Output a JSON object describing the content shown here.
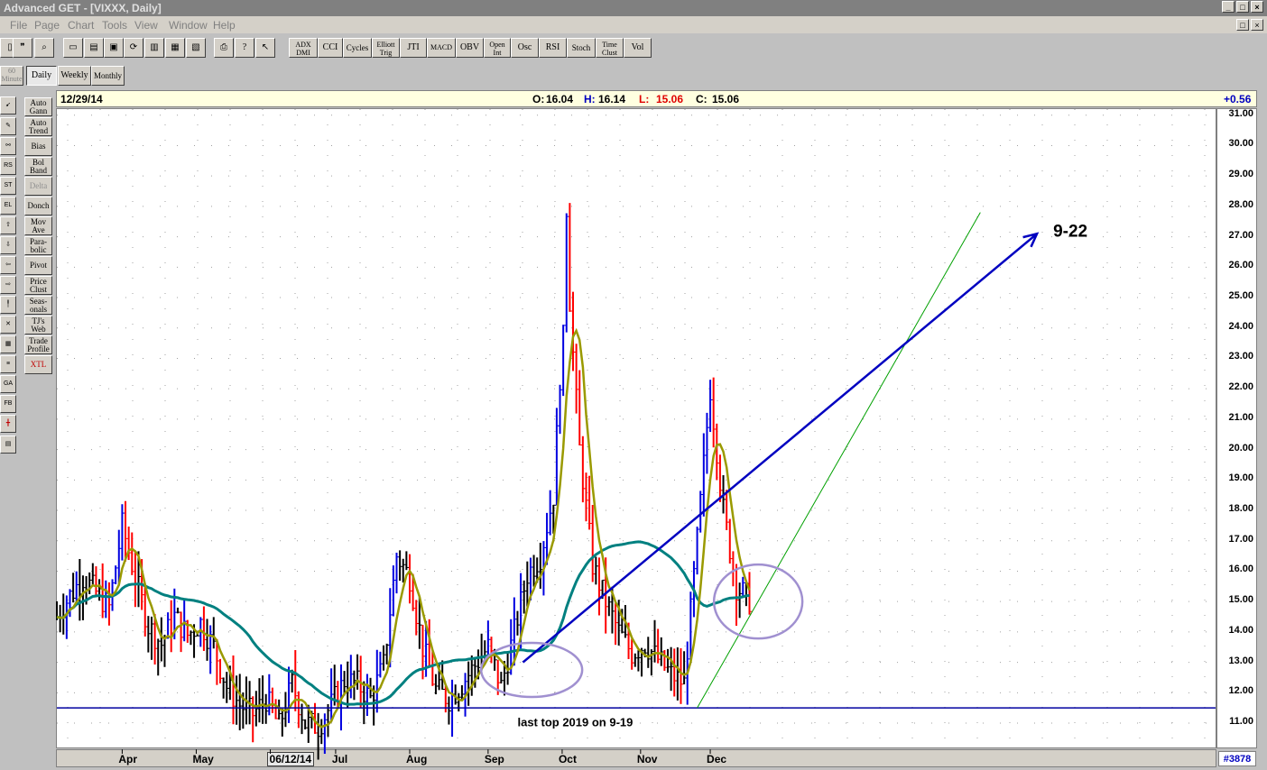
{
  "window": {
    "title": "Advanced GET - [VIXXX, Daily]",
    "controls": [
      "_",
      "□",
      "×"
    ]
  },
  "menu": [
    "File",
    "Page",
    "Chart",
    "Tools",
    "View",
    "Window",
    "Help"
  ],
  "toolbar": {
    "indicators": [
      "ADX DMI",
      "CCI",
      "Cycles",
      "Elliott Trig",
      "JTI",
      "MACD",
      "OBV",
      "Open Int",
      "Osc",
      "RSI",
      "Stoch",
      "Time Clust",
      "Vol"
    ]
  },
  "timeframe_tabs": [
    {
      "label": "60 Minute",
      "active": false
    },
    {
      "label": "Daily",
      "active": true
    },
    {
      "label": "Weekly",
      "active": false
    },
    {
      "label": "Monthly",
      "active": false
    }
  ],
  "side_tools": [
    "Auto Gann",
    "Auto Trend",
    "Bias",
    "Bol Band",
    "Delta",
    "Donch",
    "Mov Ave",
    "Para-bolic",
    "Pivot",
    "Price Clust",
    "Seas-onals",
    "TJ's Web",
    "Trade Profile",
    "XTL"
  ],
  "left_icons": [
    "pointer-icon",
    "draw-icon",
    "zoom-icon",
    "reset-icon",
    "study-icon",
    "elliott-icon",
    "arrow-up-icon",
    "arrow-down-icon",
    "arrow-left-icon",
    "arrow-right-icon",
    "line-icon",
    "x-icon",
    "grid-icon",
    "lines-icon",
    "gann-icon",
    "fib-icon",
    "cross-icon",
    "print-icon"
  ],
  "infobar": {
    "date": "12/29/14",
    "open_label": "O:",
    "open": "16.04",
    "high_label": "H:",
    "high": "16.14",
    "low_label": "L:",
    "low": "15.06",
    "close_label": "C:",
    "close": "15.06",
    "change": "+0.56"
  },
  "counter": "#3878",
  "chart_data": {
    "type": "line",
    "symbol": "VIXXX",
    "interval": "Daily",
    "ylim": [
      10.2,
      31.2
    ],
    "y_ticks": [
      "11.00",
      "12.00",
      "13.00",
      "14.00",
      "15.00",
      "16.00",
      "17.00",
      "18.00",
      "19.00",
      "20.00",
      "21.00",
      "22.00",
      "23.00",
      "24.00",
      "25.00",
      "26.00",
      "27.00",
      "28.00",
      "29.00",
      "30.00",
      "31.00"
    ],
    "x_tick_labels": [
      "Apr",
      "May",
      "06/12/14",
      "Jul",
      "Aug",
      "Sep",
      "Oct",
      "Nov",
      "Dec"
    ],
    "x_tick_positions": [
      3,
      20,
      37,
      52,
      69,
      87,
      104,
      122,
      138
    ],
    "x_range": [
      -12,
      254
    ],
    "grid": true,
    "bars_color_legend": {
      "up": "#0000e0",
      "down": "#ff0000",
      "neutral": "#000000"
    },
    "close_series": [
      {
        "x": -12,
        "close": 14.5
      },
      {
        "x": -9,
        "close": 15.2
      },
      {
        "x": -6,
        "close": 15.8
      },
      {
        "x": -3,
        "close": 15.3
      },
      {
        "x": 0,
        "close": 14.8
      },
      {
        "x": 3,
        "close": 17.5
      },
      {
        "x": 6,
        "close": 15.8
      },
      {
        "x": 9,
        "close": 14.2
      },
      {
        "x": 12,
        "close": 13.6
      },
      {
        "x": 15,
        "close": 14.5
      },
      {
        "x": 18,
        "close": 13.9
      },
      {
        "x": 21,
        "close": 14.3
      },
      {
        "x": 24,
        "close": 13.5
      },
      {
        "x": 27,
        "close": 12.2
      },
      {
        "x": 30,
        "close": 11.6
      },
      {
        "x": 33,
        "close": 11.3
      },
      {
        "x": 36,
        "close": 11.8
      },
      {
        "x": 39,
        "close": 10.9
      },
      {
        "x": 42,
        "close": 12.3
      },
      {
        "x": 45,
        "close": 11.0
      },
      {
        "x": 48,
        "close": 10.9
      },
      {
        "x": 51,
        "close": 11.6
      },
      {
        "x": 54,
        "close": 12.4
      },
      {
        "x": 57,
        "close": 12.3
      },
      {
        "x": 60,
        "close": 11.8
      },
      {
        "x": 63,
        "close": 12.9
      },
      {
        "x": 66,
        "close": 16.5
      },
      {
        "x": 69,
        "close": 15.8
      },
      {
        "x": 72,
        "close": 13.5
      },
      {
        "x": 75,
        "close": 12.1
      },
      {
        "x": 78,
        "close": 11.8
      },
      {
        "x": 81,
        "close": 12.3
      },
      {
        "x": 84,
        "close": 12.9
      },
      {
        "x": 87,
        "close": 13.5
      },
      {
        "x": 90,
        "close": 12.2
      },
      {
        "x": 93,
        "close": 14.0
      },
      {
        "x": 96,
        "close": 15.9
      },
      {
        "x": 99,
        "close": 16.5
      },
      {
        "x": 102,
        "close": 18.5
      },
      {
        "x": 105,
        "close": 26.3
      },
      {
        "x": 108,
        "close": 20.0
      },
      {
        "x": 111,
        "close": 16.2
      },
      {
        "x": 114,
        "close": 15.0
      },
      {
        "x": 117,
        "close": 14.0
      },
      {
        "x": 120,
        "close": 13.3
      },
      {
        "x": 123,
        "close": 13.6
      },
      {
        "x": 126,
        "close": 13.1
      },
      {
        "x": 129,
        "close": 12.6
      },
      {
        "x": 132,
        "close": 12.3
      },
      {
        "x": 135,
        "close": 17.0
      },
      {
        "x": 138,
        "close": 22.0
      },
      {
        "x": 141,
        "close": 18.0
      },
      {
        "x": 144,
        "close": 15.5
      },
      {
        "x": 147,
        "close": 15.06
      }
    ],
    "annotations": [
      {
        "text": "9-22",
        "kind": "label"
      },
      {
        "text": "last top 2019 on 9-19",
        "kind": "label"
      }
    ]
  }
}
